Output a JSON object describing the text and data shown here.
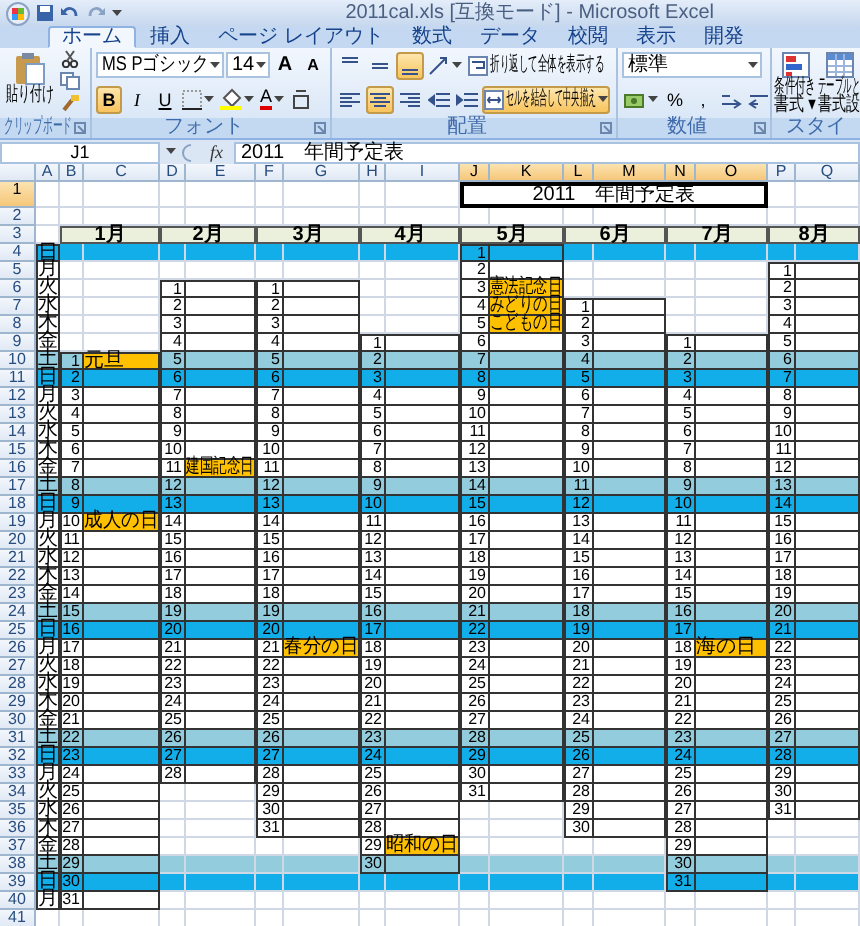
{
  "window": {
    "title": "2011cal.xls [互換モード] - Microsoft Excel"
  },
  "tabs": [
    {
      "label": "ホーム",
      "selected": true
    },
    {
      "label": "挿入",
      "selected": false
    },
    {
      "label": "ページ レイアウト",
      "selected": false
    },
    {
      "label": "数式",
      "selected": false
    },
    {
      "label": "データ",
      "selected": false
    },
    {
      "label": "校閲",
      "selected": false
    },
    {
      "label": "表示",
      "selected": false
    },
    {
      "label": "開発",
      "selected": false
    }
  ],
  "ribbon": {
    "clipboard": {
      "label": "クリップボード",
      "paste": "貼り付け"
    },
    "font": {
      "label": "フォント",
      "font_name": "MS Pゴシック",
      "font_size": "14",
      "size_buttons": [
        "A",
        "A"
      ],
      "styles": [
        {
          "label": "B",
          "selected": true
        },
        {
          "label": "I",
          "selected": false
        },
        {
          "label": "U",
          "selected": false
        }
      ],
      "color_button": "A"
    },
    "alignment": {
      "label": "配置",
      "vertical": [
        {
          "kind": "top",
          "selected": false
        },
        {
          "kind": "middle",
          "selected": false
        },
        {
          "kind": "bottom",
          "selected": true
        }
      ],
      "horizontal": [
        {
          "kind": "left",
          "selected": false
        },
        {
          "kind": "center",
          "selected": true
        },
        {
          "kind": "right",
          "selected": false
        }
      ],
      "wrap_text": "折り返して全体を表示する",
      "merge": {
        "label": "セルを結合して中央揃え",
        "selected": true
      }
    },
    "number": {
      "label": "数値",
      "format": "標準",
      "buttons": [
        "%",
        ","
      ]
    },
    "styles": {
      "label": "スタイ",
      "conditional": [
        "条件付き",
        "書式 ▾"
      ],
      "table": [
        "テーブルと",
        "書式設"
      ]
    }
  },
  "formula_bar": {
    "name_box": "J1",
    "function_label": "fx",
    "formula": "2011　年間予定表"
  },
  "sheet": {
    "columns": [
      {
        "label": "A",
        "selected": false
      },
      {
        "label": "B",
        "selected": false
      },
      {
        "label": "C",
        "selected": false
      },
      {
        "label": "D",
        "selected": false
      },
      {
        "label": "E",
        "selected": false
      },
      {
        "label": "F",
        "selected": false
      },
      {
        "label": "G",
        "selected": false
      },
      {
        "label": "H",
        "selected": false
      },
      {
        "label": "I",
        "selected": false
      },
      {
        "label": "J",
        "selected": true
      },
      {
        "label": "K",
        "selected": true
      },
      {
        "label": "L",
        "selected": true
      },
      {
        "label": "M",
        "selected": true
      },
      {
        "label": "N",
        "selected": true
      },
      {
        "label": "O",
        "selected": true
      },
      {
        "label": "P",
        "selected": false
      },
      {
        "label": "Q",
        "selected": false
      }
    ],
    "rows": [
      {
        "header": "1",
        "selected": true,
        "kind": "title",
        "title": "2011　年間予定表"
      },
      {
        "header": "2",
        "selected": false,
        "kind": "blank"
      },
      {
        "header": "3",
        "selected": false,
        "kind": "months",
        "months": [
          "1月",
          "2月",
          "3月",
          "4月",
          "5月",
          "6月",
          "7月",
          "8月"
        ]
      },
      {
        "header": "4",
        "selected": false,
        "kind": "sun",
        "weekday": "日",
        "cells": [
          {
            "kind": "outside"
          },
          {
            "kind": "outside"
          },
          {
            "kind": "outside"
          },
          {
            "kind": "outside"
          },
          {
            "kind": "day",
            "day": "1"
          },
          {
            "kind": "outside"
          },
          {
            "kind": "outside"
          },
          {
            "kind": "outside"
          }
        ]
      },
      {
        "header": "5",
        "selected": false,
        "kind": "weekday",
        "weekday": "月",
        "cells": [
          {
            "kind": "outside"
          },
          {
            "kind": "outside"
          },
          {
            "kind": "outside"
          },
          {
            "kind": "outside"
          },
          {
            "kind": "day",
            "day": "2"
          },
          {
            "kind": "outside"
          },
          {
            "kind": "outside"
          },
          {
            "kind": "day",
            "day": "1"
          }
        ]
      },
      {
        "header": "6",
        "selected": false,
        "kind": "weekday",
        "weekday": "火",
        "cells": [
          {
            "kind": "outside"
          },
          {
            "kind": "day",
            "day": "1"
          },
          {
            "kind": "day",
            "day": "1"
          },
          {
            "kind": "outside"
          },
          {
            "kind": "day",
            "day": "3",
            "holiday": "憲法記念日"
          },
          {
            "kind": "outside"
          },
          {
            "kind": "outside"
          },
          {
            "kind": "day",
            "day": "2"
          }
        ]
      },
      {
        "header": "7",
        "selected": false,
        "kind": "weekday",
        "weekday": "水",
        "cells": [
          {
            "kind": "outside"
          },
          {
            "kind": "day",
            "day": "2"
          },
          {
            "kind": "day",
            "day": "2"
          },
          {
            "kind": "outside"
          },
          {
            "kind": "day",
            "day": "4",
            "holiday": "みどりの日"
          },
          {
            "kind": "day",
            "day": "1"
          },
          {
            "kind": "outside"
          },
          {
            "kind": "day",
            "day": "3"
          }
        ]
      },
      {
        "header": "8",
        "selected": false,
        "kind": "weekday",
        "weekday": "木",
        "cells": [
          {
            "kind": "outside"
          },
          {
            "kind": "day",
            "day": "3"
          },
          {
            "kind": "day",
            "day": "3"
          },
          {
            "kind": "outside"
          },
          {
            "kind": "day",
            "day": "5",
            "holiday": "こどもの日"
          },
          {
            "kind": "day",
            "day": "2"
          },
          {
            "kind": "outside"
          },
          {
            "kind": "day",
            "day": "4"
          }
        ]
      },
      {
        "header": "9",
        "selected": false,
        "kind": "weekday",
        "weekday": "金",
        "cells": [
          {
            "kind": "outside"
          },
          {
            "kind": "day",
            "day": "4"
          },
          {
            "kind": "day",
            "day": "4"
          },
          {
            "kind": "day",
            "day": "1"
          },
          {
            "kind": "day",
            "day": "6"
          },
          {
            "kind": "day",
            "day": "3"
          },
          {
            "kind": "day",
            "day": "1"
          },
          {
            "kind": "day",
            "day": "5"
          }
        ]
      },
      {
        "header": "10",
        "selected": false,
        "kind": "sat",
        "weekday": "土",
        "cells": [
          {
            "kind": "day",
            "day": "1",
            "holiday": "元旦"
          },
          {
            "kind": "day",
            "day": "5"
          },
          {
            "kind": "day",
            "day": "5"
          },
          {
            "kind": "day",
            "day": "2"
          },
          {
            "kind": "day",
            "day": "7"
          },
          {
            "kind": "day",
            "day": "4"
          },
          {
            "kind": "day",
            "day": "2"
          },
          {
            "kind": "day",
            "day": "6"
          }
        ]
      },
      {
        "header": "11",
        "selected": false,
        "kind": "sun",
        "weekday": "日",
        "cells": [
          {
            "kind": "day",
            "day": "2"
          },
          {
            "kind": "day",
            "day": "6"
          },
          {
            "kind": "day",
            "day": "6"
          },
          {
            "kind": "day",
            "day": "3"
          },
          {
            "kind": "day",
            "day": "8"
          },
          {
            "kind": "day",
            "day": "5"
          },
          {
            "kind": "day",
            "day": "3"
          },
          {
            "kind": "day",
            "day": "7"
          }
        ]
      },
      {
        "header": "12",
        "selected": false,
        "kind": "weekday",
        "weekday": "月",
        "cells": [
          {
            "kind": "day",
            "day": "3"
          },
          {
            "kind": "day",
            "day": "7"
          },
          {
            "kind": "day",
            "day": "7"
          },
          {
            "kind": "day",
            "day": "4"
          },
          {
            "kind": "day",
            "day": "9"
          },
          {
            "kind": "day",
            "day": "6"
          },
          {
            "kind": "day",
            "day": "4"
          },
          {
            "kind": "day",
            "day": "8"
          }
        ]
      },
      {
        "header": "13",
        "selected": false,
        "kind": "weekday",
        "weekday": "火",
        "cells": [
          {
            "kind": "day",
            "day": "4"
          },
          {
            "kind": "day",
            "day": "8"
          },
          {
            "kind": "day",
            "day": "8"
          },
          {
            "kind": "day",
            "day": "5"
          },
          {
            "kind": "day",
            "day": "10"
          },
          {
            "kind": "day",
            "day": "7"
          },
          {
            "kind": "day",
            "day": "5"
          },
          {
            "kind": "day",
            "day": "9"
          }
        ]
      },
      {
        "header": "14",
        "selected": false,
        "kind": "weekday",
        "weekday": "水",
        "cells": [
          {
            "kind": "day",
            "day": "5"
          },
          {
            "kind": "day",
            "day": "9"
          },
          {
            "kind": "day",
            "day": "9"
          },
          {
            "kind": "day",
            "day": "6"
          },
          {
            "kind": "day",
            "day": "11"
          },
          {
            "kind": "day",
            "day": "8"
          },
          {
            "kind": "day",
            "day": "6"
          },
          {
            "kind": "day",
            "day": "10"
          }
        ]
      },
      {
        "header": "15",
        "selected": false,
        "kind": "weekday",
        "weekday": "木",
        "cells": [
          {
            "kind": "day",
            "day": "6"
          },
          {
            "kind": "day",
            "day": "10"
          },
          {
            "kind": "day",
            "day": "10"
          },
          {
            "kind": "day",
            "day": "7"
          },
          {
            "kind": "day",
            "day": "12"
          },
          {
            "kind": "day",
            "day": "9"
          },
          {
            "kind": "day",
            "day": "7"
          },
          {
            "kind": "day",
            "day": "11"
          }
        ]
      },
      {
        "header": "16",
        "selected": false,
        "kind": "weekday",
        "weekday": "金",
        "cells": [
          {
            "kind": "day",
            "day": "7"
          },
          {
            "kind": "day",
            "day": "11",
            "holiday": "建国記念日"
          },
          {
            "kind": "day",
            "day": "11"
          },
          {
            "kind": "day",
            "day": "8"
          },
          {
            "kind": "day",
            "day": "13"
          },
          {
            "kind": "day",
            "day": "10"
          },
          {
            "kind": "day",
            "day": "8"
          },
          {
            "kind": "day",
            "day": "12"
          }
        ]
      },
      {
        "header": "17",
        "selected": false,
        "kind": "sat",
        "weekday": "土",
        "cells": [
          {
            "kind": "day",
            "day": "8"
          },
          {
            "kind": "day",
            "day": "12"
          },
          {
            "kind": "day",
            "day": "12"
          },
          {
            "kind": "day",
            "day": "9"
          },
          {
            "kind": "day",
            "day": "14"
          },
          {
            "kind": "day",
            "day": "11"
          },
          {
            "kind": "day",
            "day": "9"
          },
          {
            "kind": "day",
            "day": "13"
          }
        ]
      },
      {
        "header": "18",
        "selected": false,
        "kind": "sun",
        "weekday": "日",
        "cells": [
          {
            "kind": "day",
            "day": "9"
          },
          {
            "kind": "day",
            "day": "13"
          },
          {
            "kind": "day",
            "day": "13"
          },
          {
            "kind": "day",
            "day": "10"
          },
          {
            "kind": "day",
            "day": "15"
          },
          {
            "kind": "day",
            "day": "12"
          },
          {
            "kind": "day",
            "day": "10"
          },
          {
            "kind": "day",
            "day": "14"
          }
        ]
      },
      {
        "header": "19",
        "selected": false,
        "kind": "weekday",
        "weekday": "月",
        "cells": [
          {
            "kind": "day",
            "day": "10",
            "holiday": "成人の日"
          },
          {
            "kind": "day",
            "day": "14"
          },
          {
            "kind": "day",
            "day": "14"
          },
          {
            "kind": "day",
            "day": "11"
          },
          {
            "kind": "day",
            "day": "16"
          },
          {
            "kind": "day",
            "day": "13"
          },
          {
            "kind": "day",
            "day": "11"
          },
          {
            "kind": "day",
            "day": "15"
          }
        ]
      },
      {
        "header": "20",
        "selected": false,
        "kind": "weekday",
        "weekday": "火",
        "cells": [
          {
            "kind": "day",
            "day": "11"
          },
          {
            "kind": "day",
            "day": "15"
          },
          {
            "kind": "day",
            "day": "15"
          },
          {
            "kind": "day",
            "day": "12"
          },
          {
            "kind": "day",
            "day": "17"
          },
          {
            "kind": "day",
            "day": "14"
          },
          {
            "kind": "day",
            "day": "12"
          },
          {
            "kind": "day",
            "day": "16"
          }
        ]
      },
      {
        "header": "21",
        "selected": false,
        "kind": "weekday",
        "weekday": "水",
        "cells": [
          {
            "kind": "day",
            "day": "12"
          },
          {
            "kind": "day",
            "day": "16"
          },
          {
            "kind": "day",
            "day": "16"
          },
          {
            "kind": "day",
            "day": "13"
          },
          {
            "kind": "day",
            "day": "18"
          },
          {
            "kind": "day",
            "day": "15"
          },
          {
            "kind": "day",
            "day": "13"
          },
          {
            "kind": "day",
            "day": "17"
          }
        ]
      },
      {
        "header": "22",
        "selected": false,
        "kind": "weekday",
        "weekday": "木",
        "cells": [
          {
            "kind": "day",
            "day": "13"
          },
          {
            "kind": "day",
            "day": "17"
          },
          {
            "kind": "day",
            "day": "17"
          },
          {
            "kind": "day",
            "day": "14"
          },
          {
            "kind": "day",
            "day": "19"
          },
          {
            "kind": "day",
            "day": "16"
          },
          {
            "kind": "day",
            "day": "14"
          },
          {
            "kind": "day",
            "day": "18"
          }
        ]
      },
      {
        "header": "23",
        "selected": false,
        "kind": "weekday",
        "weekday": "金",
        "cells": [
          {
            "kind": "day",
            "day": "14"
          },
          {
            "kind": "day",
            "day": "18"
          },
          {
            "kind": "day",
            "day": "18"
          },
          {
            "kind": "day",
            "day": "15"
          },
          {
            "kind": "day",
            "day": "20"
          },
          {
            "kind": "day",
            "day": "17"
          },
          {
            "kind": "day",
            "day": "15"
          },
          {
            "kind": "day",
            "day": "19"
          }
        ]
      },
      {
        "header": "24",
        "selected": false,
        "kind": "sat",
        "weekday": "土",
        "cells": [
          {
            "kind": "day",
            "day": "15"
          },
          {
            "kind": "day",
            "day": "19"
          },
          {
            "kind": "day",
            "day": "19"
          },
          {
            "kind": "day",
            "day": "16"
          },
          {
            "kind": "day",
            "day": "21"
          },
          {
            "kind": "day",
            "day": "18"
          },
          {
            "kind": "day",
            "day": "16"
          },
          {
            "kind": "day",
            "day": "20"
          }
        ]
      },
      {
        "header": "25",
        "selected": false,
        "kind": "sun",
        "weekday": "日",
        "cells": [
          {
            "kind": "day",
            "day": "16"
          },
          {
            "kind": "day",
            "day": "20"
          },
          {
            "kind": "day",
            "day": "20"
          },
          {
            "kind": "day",
            "day": "17"
          },
          {
            "kind": "day",
            "day": "22"
          },
          {
            "kind": "day",
            "day": "19"
          },
          {
            "kind": "day",
            "day": "17"
          },
          {
            "kind": "day",
            "day": "21"
          }
        ]
      },
      {
        "header": "26",
        "selected": false,
        "kind": "weekday",
        "weekday": "月",
        "cells": [
          {
            "kind": "day",
            "day": "17"
          },
          {
            "kind": "day",
            "day": "21"
          },
          {
            "kind": "day",
            "day": "21",
            "holiday": "春分の日"
          },
          {
            "kind": "day",
            "day": "18"
          },
          {
            "kind": "day",
            "day": "23"
          },
          {
            "kind": "day",
            "day": "20"
          },
          {
            "kind": "day",
            "day": "18",
            "holiday": "海の日"
          },
          {
            "kind": "day",
            "day": "22"
          }
        ]
      },
      {
        "header": "27",
        "selected": false,
        "kind": "weekday",
        "weekday": "火",
        "cells": [
          {
            "kind": "day",
            "day": "18"
          },
          {
            "kind": "day",
            "day": "22"
          },
          {
            "kind": "day",
            "day": "22"
          },
          {
            "kind": "day",
            "day": "19"
          },
          {
            "kind": "day",
            "day": "24"
          },
          {
            "kind": "day",
            "day": "21"
          },
          {
            "kind": "day",
            "day": "19"
          },
          {
            "kind": "day",
            "day": "23"
          }
        ]
      },
      {
        "header": "28",
        "selected": false,
        "kind": "weekday",
        "weekday": "水",
        "cells": [
          {
            "kind": "day",
            "day": "19"
          },
          {
            "kind": "day",
            "day": "23"
          },
          {
            "kind": "day",
            "day": "23"
          },
          {
            "kind": "day",
            "day": "20"
          },
          {
            "kind": "day",
            "day": "25"
          },
          {
            "kind": "day",
            "day": "22"
          },
          {
            "kind": "day",
            "day": "20"
          },
          {
            "kind": "day",
            "day": "24"
          }
        ]
      },
      {
        "header": "29",
        "selected": false,
        "kind": "weekday",
        "weekday": "木",
        "cells": [
          {
            "kind": "day",
            "day": "20"
          },
          {
            "kind": "day",
            "day": "24"
          },
          {
            "kind": "day",
            "day": "24"
          },
          {
            "kind": "day",
            "day": "21"
          },
          {
            "kind": "day",
            "day": "26"
          },
          {
            "kind": "day",
            "day": "23"
          },
          {
            "kind": "day",
            "day": "21"
          },
          {
            "kind": "day",
            "day": "25"
          }
        ]
      },
      {
        "header": "30",
        "selected": false,
        "kind": "weekday",
        "weekday": "金",
        "cells": [
          {
            "kind": "day",
            "day": "21"
          },
          {
            "kind": "day",
            "day": "25"
          },
          {
            "kind": "day",
            "day": "25"
          },
          {
            "kind": "day",
            "day": "22"
          },
          {
            "kind": "day",
            "day": "27"
          },
          {
            "kind": "day",
            "day": "24"
          },
          {
            "kind": "day",
            "day": "22"
          },
          {
            "kind": "day",
            "day": "26"
          }
        ]
      },
      {
        "header": "31",
        "selected": false,
        "kind": "sat",
        "weekday": "土",
        "cells": [
          {
            "kind": "day",
            "day": "22"
          },
          {
            "kind": "day",
            "day": "26"
          },
          {
            "kind": "day",
            "day": "26"
          },
          {
            "kind": "day",
            "day": "23"
          },
          {
            "kind": "day",
            "day": "28"
          },
          {
            "kind": "day",
            "day": "25"
          },
          {
            "kind": "day",
            "day": "23"
          },
          {
            "kind": "day",
            "day": "27"
          }
        ]
      },
      {
        "header": "32",
        "selected": false,
        "kind": "sun",
        "weekday": "日",
        "cells": [
          {
            "kind": "day",
            "day": "23"
          },
          {
            "kind": "day",
            "day": "27"
          },
          {
            "kind": "day",
            "day": "27"
          },
          {
            "kind": "day",
            "day": "24"
          },
          {
            "kind": "day",
            "day": "29"
          },
          {
            "kind": "day",
            "day": "26"
          },
          {
            "kind": "day",
            "day": "24"
          },
          {
            "kind": "day",
            "day": "28"
          }
        ]
      },
      {
        "header": "33",
        "selected": false,
        "kind": "weekday",
        "weekday": "月",
        "cells": [
          {
            "kind": "day",
            "day": "24"
          },
          {
            "kind": "day",
            "day": "28"
          },
          {
            "kind": "day",
            "day": "28"
          },
          {
            "kind": "day",
            "day": "25"
          },
          {
            "kind": "day",
            "day": "30"
          },
          {
            "kind": "day",
            "day": "27"
          },
          {
            "kind": "day",
            "day": "25"
          },
          {
            "kind": "day",
            "day": "29"
          }
        ]
      },
      {
        "header": "34",
        "selected": false,
        "kind": "weekday",
        "weekday": "火",
        "cells": [
          {
            "kind": "day",
            "day": "25"
          },
          {
            "kind": "outside"
          },
          {
            "kind": "day",
            "day": "29"
          },
          {
            "kind": "day",
            "day": "26"
          },
          {
            "kind": "day",
            "day": "31"
          },
          {
            "kind": "day",
            "day": "28"
          },
          {
            "kind": "day",
            "day": "26"
          },
          {
            "kind": "day",
            "day": "30"
          }
        ]
      },
      {
        "header": "35",
        "selected": false,
        "kind": "weekday",
        "weekday": "水",
        "cells": [
          {
            "kind": "day",
            "day": "26"
          },
          {
            "kind": "outside"
          },
          {
            "kind": "day",
            "day": "30"
          },
          {
            "kind": "day",
            "day": "27"
          },
          {
            "kind": "outside"
          },
          {
            "kind": "day",
            "day": "29"
          },
          {
            "kind": "day",
            "day": "27"
          },
          {
            "kind": "day",
            "day": "31"
          }
        ]
      },
      {
        "header": "36",
        "selected": false,
        "kind": "weekday",
        "weekday": "木",
        "cells": [
          {
            "kind": "day",
            "day": "27"
          },
          {
            "kind": "outside"
          },
          {
            "kind": "day",
            "day": "31"
          },
          {
            "kind": "day",
            "day": "28"
          },
          {
            "kind": "outside"
          },
          {
            "kind": "day",
            "day": "30"
          },
          {
            "kind": "day",
            "day": "28"
          },
          {
            "kind": "outside"
          }
        ]
      },
      {
        "header": "37",
        "selected": false,
        "kind": "weekday",
        "weekday": "金",
        "cells": [
          {
            "kind": "day",
            "day": "28"
          },
          {
            "kind": "outside"
          },
          {
            "kind": "outside"
          },
          {
            "kind": "day",
            "day": "29",
            "holiday": "昭和の日"
          },
          {
            "kind": "outside"
          },
          {
            "kind": "outside"
          },
          {
            "kind": "day",
            "day": "29"
          },
          {
            "kind": "outside"
          }
        ]
      },
      {
        "header": "38",
        "selected": false,
        "kind": "sat",
        "weekday": "土",
        "cells": [
          {
            "kind": "day",
            "day": "29"
          },
          {
            "kind": "outside"
          },
          {
            "kind": "outside"
          },
          {
            "kind": "day",
            "day": "30"
          },
          {
            "kind": "outside"
          },
          {
            "kind": "outside"
          },
          {
            "kind": "day",
            "day": "30"
          },
          {
            "kind": "outside"
          }
        ]
      },
      {
        "header": "39",
        "selected": false,
        "kind": "sun",
        "weekday": "日",
        "cells": [
          {
            "kind": "day",
            "day": "30"
          },
          {
            "kind": "outside"
          },
          {
            "kind": "outside"
          },
          {
            "kind": "outside"
          },
          {
            "kind": "outside"
          },
          {
            "kind": "outside"
          },
          {
            "kind": "day",
            "day": "31"
          },
          {
            "kind": "outside"
          }
        ]
      },
      {
        "header": "40",
        "selected": false,
        "kind": "weekday",
        "weekday": "月",
        "cells": [
          {
            "kind": "day",
            "day": "31"
          },
          {
            "kind": "outside"
          },
          {
            "kind": "outside"
          },
          {
            "kind": "outside"
          },
          {
            "kind": "outside"
          },
          {
            "kind": "outside"
          },
          {
            "kind": "outside"
          },
          {
            "kind": "outside"
          }
        ]
      },
      {
        "header": "41",
        "selected": false,
        "kind": "blank"
      }
    ]
  }
}
